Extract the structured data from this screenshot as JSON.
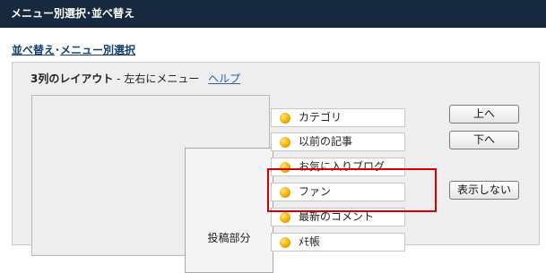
{
  "title_bar": {
    "title": "メニュー別選択･並べ替え"
  },
  "breadcrumb": {
    "sort_link": "並べ替え",
    "separator": "･",
    "menu_select_link": "メニュー別選択"
  },
  "layout": {
    "name": "3列のレイアウト",
    "dash": " - ",
    "description": "左右にメニュー",
    "help_link": "ヘルプ"
  },
  "preview": {
    "post_area_label": "投稿部分"
  },
  "menu_items": [
    {
      "label": "カテゴリ"
    },
    {
      "label": "以前の記事"
    },
    {
      "label": "お気に入りブログ"
    },
    {
      "label": "ファン"
    },
    {
      "label": "最新のコメント"
    },
    {
      "label": "ﾒﾓ帳"
    }
  ],
  "buttons": {
    "up": "上へ",
    "down": "下へ",
    "hide": "表示しない"
  },
  "colors": {
    "title_bar": "#17293f",
    "link": "#14406d",
    "selection_highlight": "#d40000",
    "bullet": "#f0b100"
  },
  "selected_item": "ファン"
}
